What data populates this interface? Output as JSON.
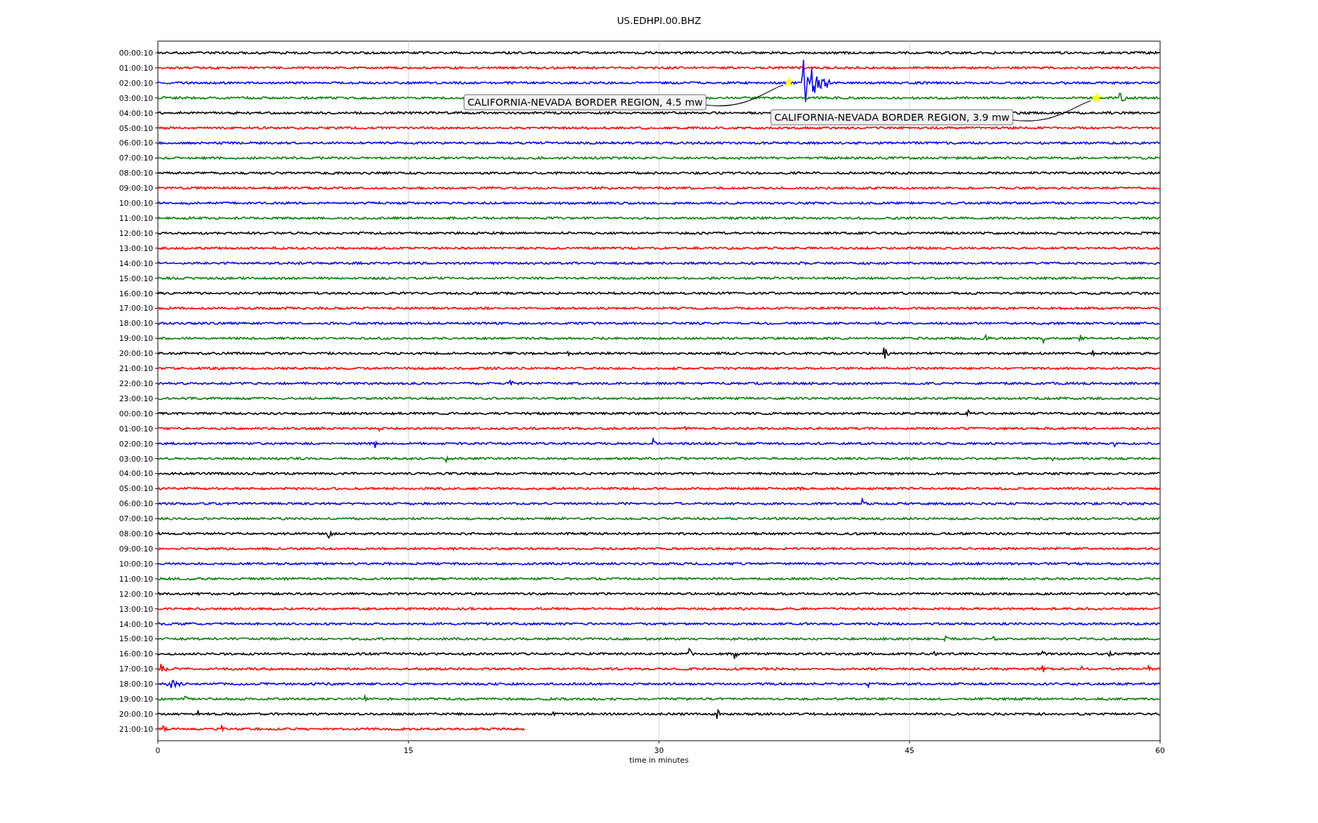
{
  "title": "US.EDHPI.00.BHZ",
  "rows": [
    {
      "label": "00:00:10",
      "color": "#000000"
    },
    {
      "label": "01:00:10",
      "color": "#ff0000"
    },
    {
      "label": "02:00:10",
      "color": "#0000ff"
    },
    {
      "label": "03:00:10",
      "color": "#008000"
    },
    {
      "label": "04:00:10",
      "color": "#000000"
    },
    {
      "label": "05:00:10",
      "color": "#ff0000"
    },
    {
      "label": "06:00:10",
      "color": "#0000ff"
    },
    {
      "label": "07:00:10",
      "color": "#008000"
    },
    {
      "label": "08:00:10",
      "color": "#000000"
    },
    {
      "label": "09:00:10",
      "color": "#ff0000"
    },
    {
      "label": "10:00:10",
      "color": "#0000ff"
    },
    {
      "label": "11:00:10",
      "color": "#008000"
    },
    {
      "label": "12:00:10",
      "color": "#000000"
    },
    {
      "label": "13:00:10",
      "color": "#ff0000"
    },
    {
      "label": "14:00:10",
      "color": "#0000ff"
    },
    {
      "label": "15:00:10",
      "color": "#008000"
    },
    {
      "label": "16:00:10",
      "color": "#000000"
    },
    {
      "label": "17:00:10",
      "color": "#ff0000"
    },
    {
      "label": "18:00:10",
      "color": "#0000ff"
    },
    {
      "label": "19:00:10",
      "color": "#008000"
    },
    {
      "label": "20:00:10",
      "color": "#000000"
    },
    {
      "label": "21:00:10",
      "color": "#ff0000"
    },
    {
      "label": "22:00:10",
      "color": "#0000ff"
    },
    {
      "label": "23:00:10",
      "color": "#008000"
    },
    {
      "label": "00:00:10",
      "color": "#000000"
    },
    {
      "label": "01:00:10",
      "color": "#ff0000"
    },
    {
      "label": "02:00:10",
      "color": "#0000ff"
    },
    {
      "label": "03:00:10",
      "color": "#008000"
    },
    {
      "label": "04:00:10",
      "color": "#000000"
    },
    {
      "label": "05:00:10",
      "color": "#ff0000"
    },
    {
      "label": "06:00:10",
      "color": "#0000ff"
    },
    {
      "label": "07:00:10",
      "color": "#008000"
    },
    {
      "label": "08:00:10",
      "color": "#000000"
    },
    {
      "label": "09:00:10",
      "color": "#ff0000"
    },
    {
      "label": "10:00:10",
      "color": "#0000ff"
    },
    {
      "label": "11:00:10",
      "color": "#008000"
    },
    {
      "label": "12:00:10",
      "color": "#000000"
    },
    {
      "label": "13:00:10",
      "color": "#ff0000"
    },
    {
      "label": "14:00:10",
      "color": "#0000ff"
    },
    {
      "label": "15:00:10",
      "color": "#008000"
    },
    {
      "label": "16:00:10",
      "color": "#000000"
    },
    {
      "label": "17:00:10",
      "color": "#ff0000"
    },
    {
      "label": "18:00:10",
      "color": "#0000ff"
    },
    {
      "label": "19:00:10",
      "color": "#008000"
    },
    {
      "label": "20:00:10",
      "color": "#000000"
    },
    {
      "label": "21:00:10",
      "color": "#ff0000"
    }
  ],
  "x_ticks": [
    "0",
    "15",
    "30",
    "45",
    "60"
  ],
  "xlabel": "time in minutes",
  "annotations": [
    {
      "text": "CALIFORNIA-NEVADA BORDER REGION, 4.5 mw"
    },
    {
      "text": "CALIFORNIA-NEVADA BORDER REGION, 3.9 mw"
    }
  ]
}
